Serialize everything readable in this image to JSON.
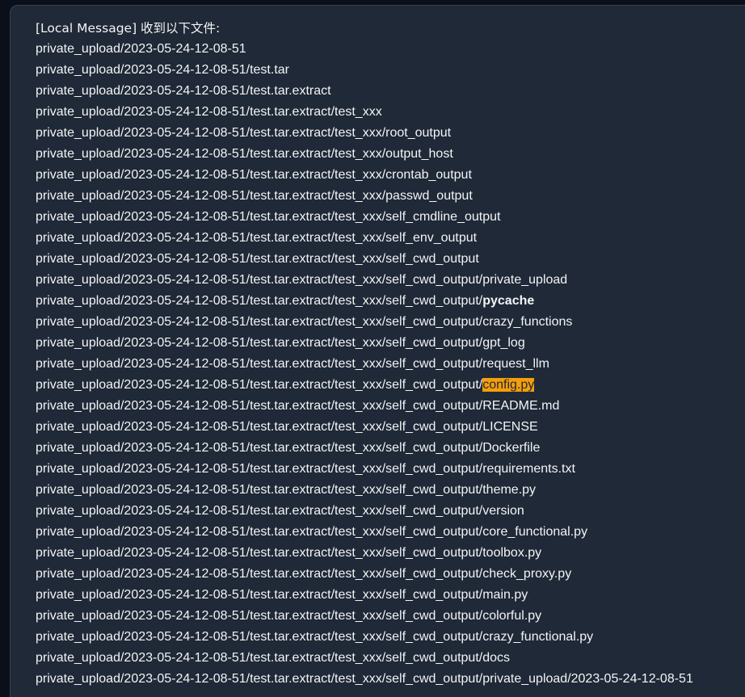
{
  "message": {
    "header": "[Local Message] 收到以下文件:",
    "prefix": "private_upload/2023-05-24-12-08-51",
    "lines": [
      "private_upload/2023-05-24-12-08-51",
      "private_upload/2023-05-24-12-08-51/test.tar",
      "private_upload/2023-05-24-12-08-51/test.tar.extract",
      "private_upload/2023-05-24-12-08-51/test.tar.extract/test_xxx",
      "private_upload/2023-05-24-12-08-51/test.tar.extract/test_xxx/root_output",
      "private_upload/2023-05-24-12-08-51/test.tar.extract/test_xxx/output_host",
      "private_upload/2023-05-24-12-08-51/test.tar.extract/test_xxx/crontab_output",
      "private_upload/2023-05-24-12-08-51/test.tar.extract/test_xxx/passwd_output",
      "private_upload/2023-05-24-12-08-51/test.tar.extract/test_xxx/self_cmdline_output",
      "private_upload/2023-05-24-12-08-51/test.tar.extract/test_xxx/self_env_output",
      "private_upload/2023-05-24-12-08-51/test.tar.extract/test_xxx/self_cwd_output",
      "private_upload/2023-05-24-12-08-51/test.tar.extract/test_xxx/self_cwd_output/private_upload"
    ],
    "pycache_line": {
      "base": "private_upload/2023-05-24-12-08-51/test.tar.extract/test_xxx/self_cwd_output/",
      "bold": "pycache"
    },
    "lines_after_pycache": [
      "private_upload/2023-05-24-12-08-51/test.tar.extract/test_xxx/self_cwd_output/crazy_functions",
      "private_upload/2023-05-24-12-08-51/test.tar.extract/test_xxx/self_cwd_output/gpt_log",
      "private_upload/2023-05-24-12-08-51/test.tar.extract/test_xxx/self_cwd_output/request_llm"
    ],
    "config_line": {
      "base": "private_upload/2023-05-24-12-08-51/test.tar.extract/test_xxx/self_cwd_output/",
      "highlight": "config.py"
    },
    "lines_after_config": [
      "private_upload/2023-05-24-12-08-51/test.tar.extract/test_xxx/self_cwd_output/README.md",
      "private_upload/2023-05-24-12-08-51/test.tar.extract/test_xxx/self_cwd_output/LICENSE",
      "private_upload/2023-05-24-12-08-51/test.tar.extract/test_xxx/self_cwd_output/Dockerfile",
      "private_upload/2023-05-24-12-08-51/test.tar.extract/test_xxx/self_cwd_output/requirements.txt",
      "private_upload/2023-05-24-12-08-51/test.tar.extract/test_xxx/self_cwd_output/theme.py",
      "private_upload/2023-05-24-12-08-51/test.tar.extract/test_xxx/self_cwd_output/version",
      "private_upload/2023-05-24-12-08-51/test.tar.extract/test_xxx/self_cwd_output/core_functional.py",
      "private_upload/2023-05-24-12-08-51/test.tar.extract/test_xxx/self_cwd_output/toolbox.py",
      "private_upload/2023-05-24-12-08-51/test.tar.extract/test_xxx/self_cwd_output/check_proxy.py",
      "private_upload/2023-05-24-12-08-51/test.tar.extract/test_xxx/self_cwd_output/main.py",
      "private_upload/2023-05-24-12-08-51/test.tar.extract/test_xxx/self_cwd_output/colorful.py",
      "private_upload/2023-05-24-12-08-51/test.tar.extract/test_xxx/self_cwd_output/crazy_functional.py",
      "private_upload/2023-05-24-12-08-51/test.tar.extract/test_xxx/self_cwd_output/docs"
    ],
    "last_line": "private_upload/2023-05-24-12-08-51/test.tar.extract/test_xxx/self_cwd_output/private_upload/2023-05-24-12-08-51"
  },
  "colors": {
    "background": "#0b0f19",
    "bubble": "#1f2937",
    "text": "#f3f4f6",
    "highlight": "#f59e0b"
  }
}
